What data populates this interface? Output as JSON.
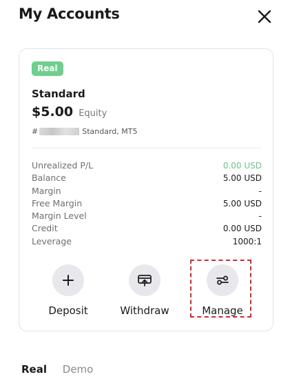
{
  "header": {
    "title": "My Accounts"
  },
  "account_card": {
    "badge": "Real",
    "account_type": "Standard",
    "equity_value": "$5.00",
    "equity_label": "Equity",
    "account_prefix": "#",
    "account_suffix": "Standard, MT5",
    "stats": [
      {
        "label": "Unrealized P/L",
        "value": "0.00 USD"
      },
      {
        "label": "Balance",
        "value": "5.00 USD"
      },
      {
        "label": "Margin",
        "value": "-"
      },
      {
        "label": "Free Margin",
        "value": "5.00 USD"
      },
      {
        "label": "Margin Level",
        "value": "-"
      },
      {
        "label": "Credit",
        "value": "0.00 USD"
      },
      {
        "label": "Leverage",
        "value": "1000:1"
      }
    ],
    "actions": [
      {
        "label": "Deposit",
        "icon": "plus-icon"
      },
      {
        "label": "Withdraw",
        "icon": "withdraw-icon"
      },
      {
        "label": "Manage",
        "icon": "settings-sliders-icon"
      }
    ]
  },
  "tabs": [
    {
      "label": "Real",
      "active": true
    },
    {
      "label": "Demo",
      "active": false
    }
  ],
  "colors": {
    "badge_green": "#6fcf8d",
    "positive_green": "#6cc38a",
    "highlight_red": "#d6262e",
    "icon_circle": "#e8e8ec"
  }
}
